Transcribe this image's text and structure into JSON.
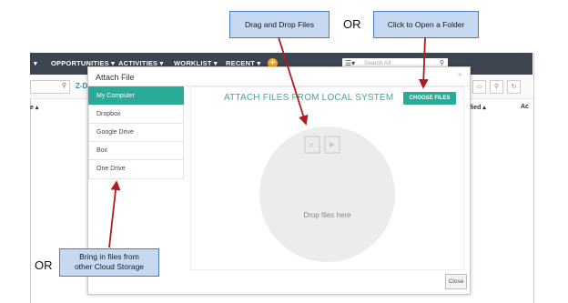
{
  "nav": {
    "items": [
      "OPPORTUNITIES ▾",
      "ACTIVITIES ▾",
      "WORKLIST ▾",
      "RECENT ▾"
    ],
    "search_placeholder": "Search All"
  },
  "subbar": {
    "link_text": "Z-D",
    "col_left": "e ▴",
    "col_right1": "ified ▴",
    "col_right2": "Ac"
  },
  "modal": {
    "title": "Attach File",
    "close_glyph": "×",
    "sources": [
      {
        "label": "My Computer",
        "active": true
      },
      {
        "label": "Dropbox",
        "active": false
      },
      {
        "label": "Google Drive",
        "active": false
      },
      {
        "label": "Box",
        "active": false
      },
      {
        "label": "One Drive",
        "active": false
      }
    ],
    "content_title": "ATTACH FILES FROM LOCAL SYSTEM",
    "choose_files_label": "CHOOSE FILES",
    "drop_text": "Drop files here",
    "close_label": "Close"
  },
  "callouts": {
    "drag": "Drag and Drop Files",
    "open": "Click to Open a Folder",
    "cloud_line1": "Bring in files from",
    "cloud_line2": "other Cloud Storage",
    "or_top": "OR",
    "or_bottom": "OR"
  },
  "colors": {
    "accent": "#2aab98",
    "nav_bg": "#3d4550",
    "callout_fill": "#c6d9f1",
    "callout_border": "#4a7ebb",
    "arrow": "#b01c1c"
  }
}
